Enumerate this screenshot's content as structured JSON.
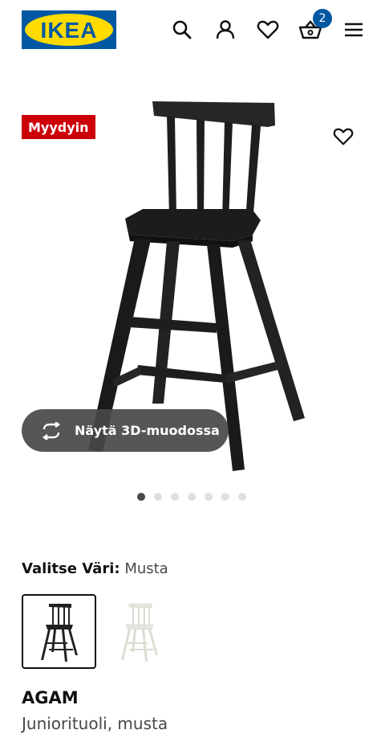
{
  "header": {
    "logo_text": "IKEA",
    "icons": [
      "search-icon",
      "account-icon",
      "heart-icon",
      "cart-icon",
      "menu-icon"
    ],
    "cart_count": "2"
  },
  "gallery": {
    "badge": "Myydyin",
    "view_3d_label": "Näytä 3D-muodossa",
    "image_count": 7,
    "active_image": 1
  },
  "color": {
    "label": "Valitse Väri:",
    "value": "Musta",
    "options": [
      "black",
      "white"
    ]
  },
  "product": {
    "name": "AGAM",
    "description": "Juniorituoli, musta"
  },
  "colors": {
    "ikea_blue": "#0058a3",
    "ikea_yellow": "#ffdb00",
    "badge_red": "#cc0008"
  }
}
